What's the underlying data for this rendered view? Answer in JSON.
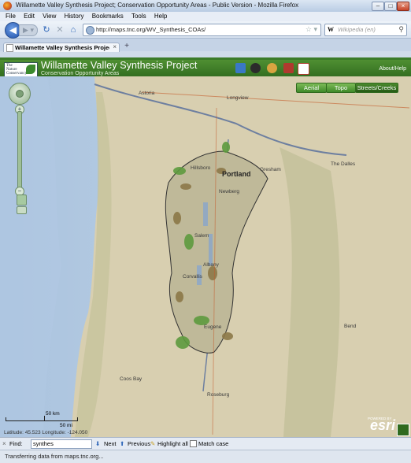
{
  "window": {
    "title": "Willamette Valley Synthesis Project; Conservation Opportunity Areas - Public Version - Mozilla Firefox"
  },
  "menu": [
    "File",
    "Edit",
    "View",
    "History",
    "Bookmarks",
    "Tools",
    "Help"
  ],
  "nav": {
    "url": "http://maps.tnc.org/WV_Synthesis_COAs/",
    "search_placeholder": "Wikipedia (en)",
    "search_engine_glyph": "W"
  },
  "tab": {
    "label": "Willamette Valley Synthesis Project; ..."
  },
  "app": {
    "logo_text": "The Nature Conservancy",
    "title": "Willamette Valley Synthesis Project",
    "subtitle": "Conservation Opportunity Areas",
    "about_help": "About/Help"
  },
  "basemaps": [
    "Aerial",
    "Topo",
    "Streets/Creeks"
  ],
  "map": {
    "places": [
      "Astoria",
      "Longview",
      "Hillsboro",
      "Portland",
      "Gresham",
      "The Dalles",
      "Newberg",
      "Salem",
      "Albany",
      "Corvallis",
      "Eugene",
      "Bend",
      "Coos Bay",
      "Roseburg"
    ],
    "scale_km": "50 km",
    "scale_mi": "50 mi",
    "coords": "Latitude: 45.523  Longitude: -124.050",
    "esri": "esri",
    "powered_by": "POWERED BY"
  },
  "find": {
    "label": "Find:",
    "value": "synthes",
    "next": "Next",
    "previous": "Previous",
    "highlight_all": "Highlight all",
    "match_case": "Match case"
  },
  "status": {
    "text": "Transferring data from maps.tnc.org..."
  },
  "colors": {
    "header_green": "#3a7a27",
    "coa_green": "#5d9a3e",
    "coa_brown": "#8c7848",
    "water": "#8fa8c6"
  }
}
